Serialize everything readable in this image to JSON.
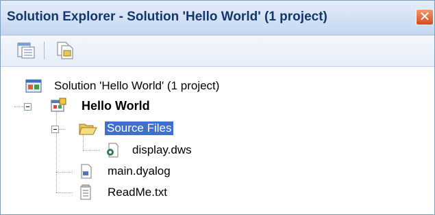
{
  "window": {
    "title": "Solution Explorer - Solution 'Hello World' (1 project)",
    "close_glyph": "✕"
  },
  "toolbar": {
    "buttons": [
      {
        "name": "properties-icon"
      },
      {
        "name": "show-all-files-icon"
      }
    ]
  },
  "tree": {
    "solution": {
      "label": "Solution 'Hello World' (1 project)",
      "icon": "solution-icon"
    },
    "project": {
      "label": "Hello World",
      "icon": "project-icon",
      "expanded": true
    },
    "folder": {
      "label": "Source Files",
      "icon": "folder-open-icon",
      "expanded": true,
      "selected": true
    },
    "files": [
      {
        "label": "display.dws",
        "icon": "dws-file-icon"
      },
      {
        "label": "main.dyalog",
        "icon": "dyalog-file-icon"
      },
      {
        "label": "ReadMe.txt",
        "icon": "text-file-icon"
      }
    ]
  },
  "colors": {
    "selection": "#3c71d0",
    "title_text": "#15366b",
    "close_button": "#d94a1f"
  }
}
